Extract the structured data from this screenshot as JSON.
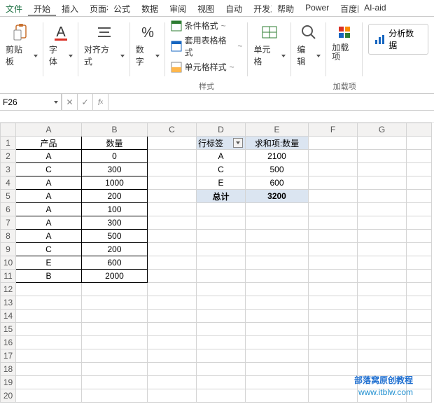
{
  "tabs": [
    "文件",
    "开始",
    "插入",
    "页面布局",
    "公式",
    "数据",
    "审阅",
    "视图",
    "自动",
    "开发工具",
    "帮助",
    "Power",
    "百度网盘",
    "AI-aid"
  ],
  "active_tab_index": 1,
  "ribbon": {
    "clipboard": "剪贴板",
    "font": "字体",
    "align": "对齐方式",
    "number": "数字",
    "styles": {
      "cond_fmt": "条件格式",
      "table_fmt": "套用表格格式",
      "cell_style": "单元格样式",
      "label": "样式"
    },
    "cells": "单元格",
    "edit": "编辑",
    "addin": "加载项",
    "addin_group": "加载项",
    "analyze": "分析数据"
  },
  "namebox": "F26",
  "formula": "",
  "cols": [
    "A",
    "B",
    "C",
    "D",
    "E",
    "F",
    "G"
  ],
  "rows": 20,
  "table": {
    "header": [
      "产品",
      "数量"
    ],
    "rows": [
      [
        "A",
        "0"
      ],
      [
        "C",
        "300"
      ],
      [
        "A",
        "1000"
      ],
      [
        "A",
        "200"
      ],
      [
        "A",
        "100"
      ],
      [
        "A",
        "300"
      ],
      [
        "A",
        "500"
      ],
      [
        "C",
        "200"
      ],
      [
        "E",
        "600"
      ],
      [
        "B",
        "2000"
      ]
    ]
  },
  "pivot": {
    "rowlabel": "行标签",
    "vallabel": "求和项:数量",
    "rows": [
      [
        "A",
        "2100"
      ],
      [
        "C",
        "500"
      ],
      [
        "E",
        "600"
      ]
    ],
    "total_label": "总计",
    "total_value": "3200"
  },
  "watermark": {
    "line1": "部落窝原创教程",
    "line2": "www.itblw.com"
  },
  "chart_data": {
    "type": "table",
    "title": "",
    "source_table": {
      "columns": [
        "产品",
        "数量"
      ],
      "data": [
        [
          "A",
          0
        ],
        [
          "C",
          300
        ],
        [
          "A",
          1000
        ],
        [
          "A",
          200
        ],
        [
          "A",
          100
        ],
        [
          "A",
          300
        ],
        [
          "A",
          500
        ],
        [
          "C",
          200
        ],
        [
          "E",
          600
        ],
        [
          "B",
          2000
        ]
      ]
    },
    "pivot_summary": {
      "row_field": "产品",
      "value_field": "数量",
      "aggregation": "sum",
      "data": [
        [
          "A",
          2100
        ],
        [
          "C",
          500
        ],
        [
          "E",
          600
        ]
      ],
      "grand_total": 3200
    }
  }
}
